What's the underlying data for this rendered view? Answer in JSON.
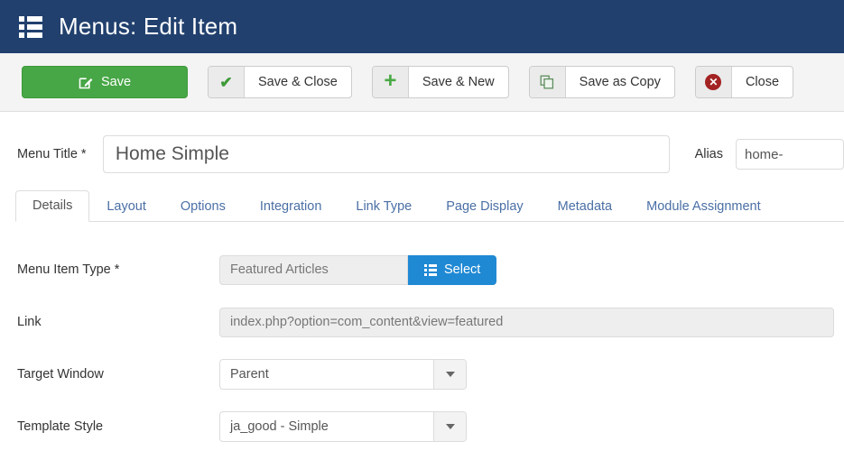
{
  "header": {
    "title": "Menus: Edit Item",
    "icon": "list-view-icon",
    "bg_color": "#21406e"
  },
  "toolbar": {
    "buttons": [
      {
        "label": "Save",
        "icon": "pencil-square-icon",
        "style": "primary",
        "color": "#47a645"
      },
      {
        "label": "Save & Close",
        "icon": "check-icon",
        "style": "split"
      },
      {
        "label": "Save & New",
        "icon": "plus-icon",
        "style": "split"
      },
      {
        "label": "Save as Copy",
        "icon": "copy-icon",
        "style": "split"
      },
      {
        "label": "Close",
        "icon": "close-circle-icon",
        "style": "split"
      }
    ]
  },
  "title_row": {
    "menu_title_label": "Menu Title *",
    "menu_title_value": "Home Simple",
    "menu_title_placeholder": "",
    "alias_label": "Alias",
    "alias_value": "home-",
    "alias_placeholder": ""
  },
  "tabs": {
    "active": "Details",
    "items": [
      {
        "label": "Details"
      },
      {
        "label": "Layout"
      },
      {
        "label": "Options"
      },
      {
        "label": "Integration"
      },
      {
        "label": "Link Type"
      },
      {
        "label": "Page Display"
      },
      {
        "label": "Metadata"
      },
      {
        "label": "Module Assignment"
      }
    ]
  },
  "form": {
    "menu_item_type": {
      "label": "Menu Item Type *",
      "value": "Featured Articles",
      "button_label": "Select",
      "button_icon": "list-view-icon",
      "button_color": "#2089d4"
    },
    "link": {
      "label": "Link",
      "value": "index.php?option=com_content&view=featured"
    },
    "target_window": {
      "label": "Target Window",
      "value": "Parent"
    },
    "template_style": {
      "label": "Template Style",
      "value": "ja_good - Simple"
    }
  }
}
